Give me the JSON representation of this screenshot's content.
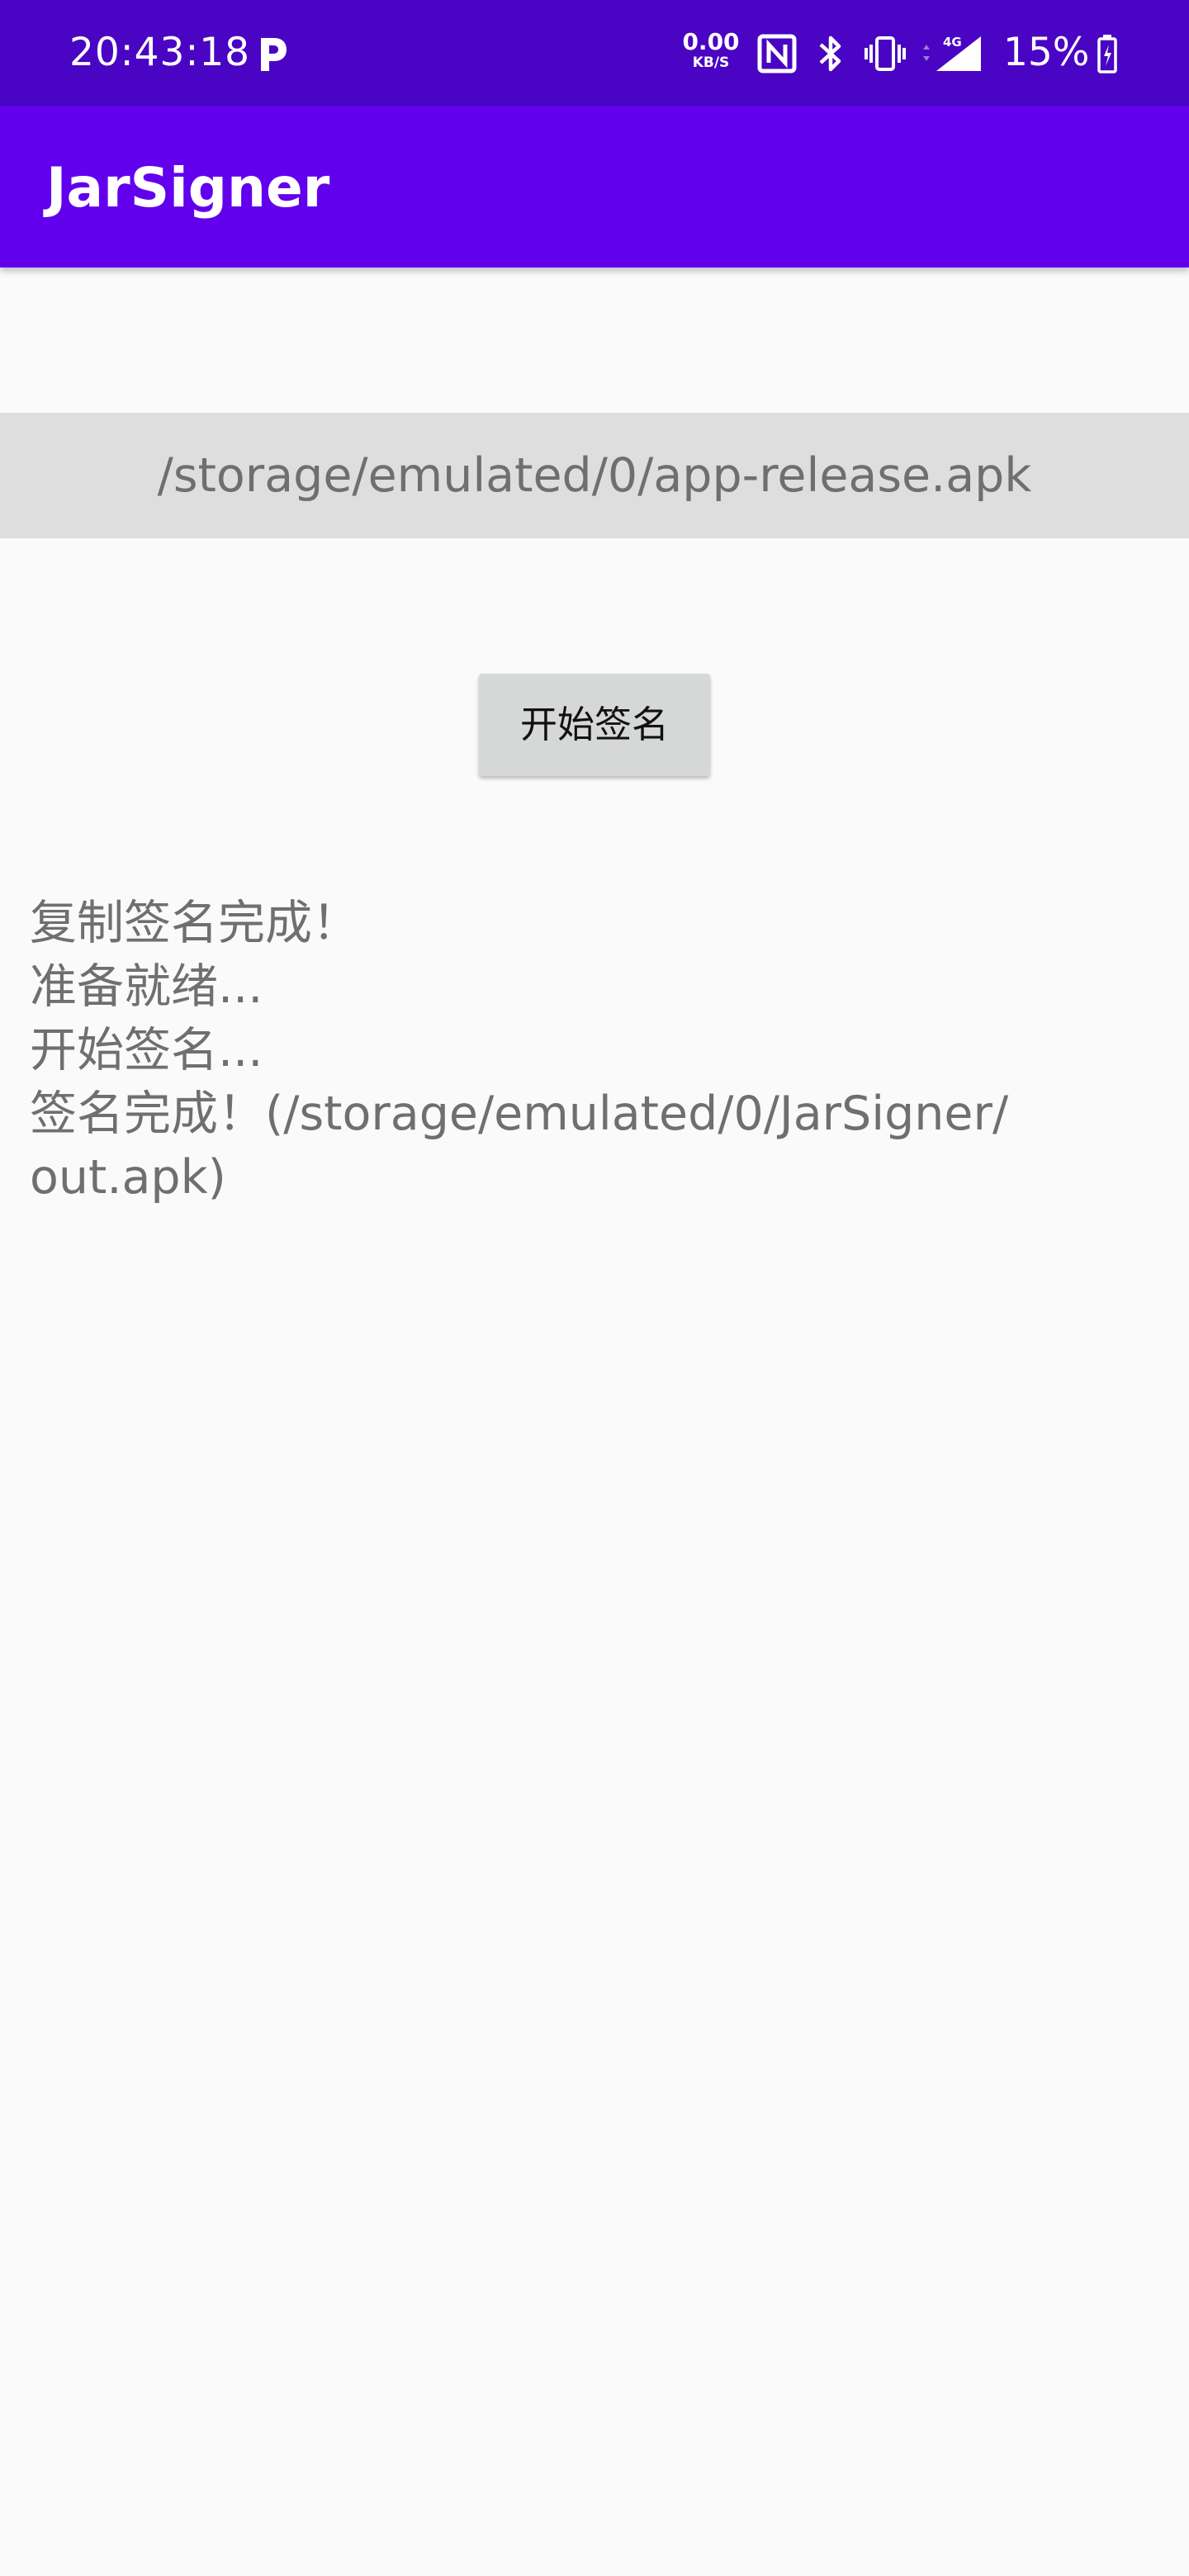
{
  "status_bar": {
    "time": "20:43:18",
    "net_speed_value": "0.00",
    "net_speed_unit": "KB/S",
    "network_type": "4G",
    "battery_percent": "15%",
    "icons": [
      "parking-app-icon",
      "nfc-icon",
      "bluetooth-icon",
      "vibrate-icon",
      "signal-icon",
      "battery-icon"
    ]
  },
  "app_bar": {
    "title": "JarSigner",
    "color": "#6200ee"
  },
  "main": {
    "file_path": "/storage/emulated/0/app-release.apk",
    "start_button_label": "开始签名",
    "log_lines": [
      "复制签名完成！",
      "准备就绪...",
      "开始签名...",
      "签名完成！(/storage/emulated/0/JarSigner/",
      "out.apk)"
    ]
  }
}
